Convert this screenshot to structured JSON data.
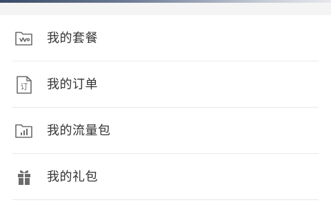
{
  "menu": {
    "items": [
      {
        "label": "我的套餐",
        "icon": "package-folder-icon"
      },
      {
        "label": "我的订单",
        "icon": "order-document-icon"
      },
      {
        "label": "我的流量包",
        "icon": "data-usage-folder-icon"
      },
      {
        "label": "我的礼包",
        "icon": "gift-icon"
      }
    ]
  },
  "colors": {
    "text": "#333333",
    "divider": "#e8e8e8",
    "icon": "#6b6b6b",
    "header_gradient_start": "#3a4a66"
  }
}
